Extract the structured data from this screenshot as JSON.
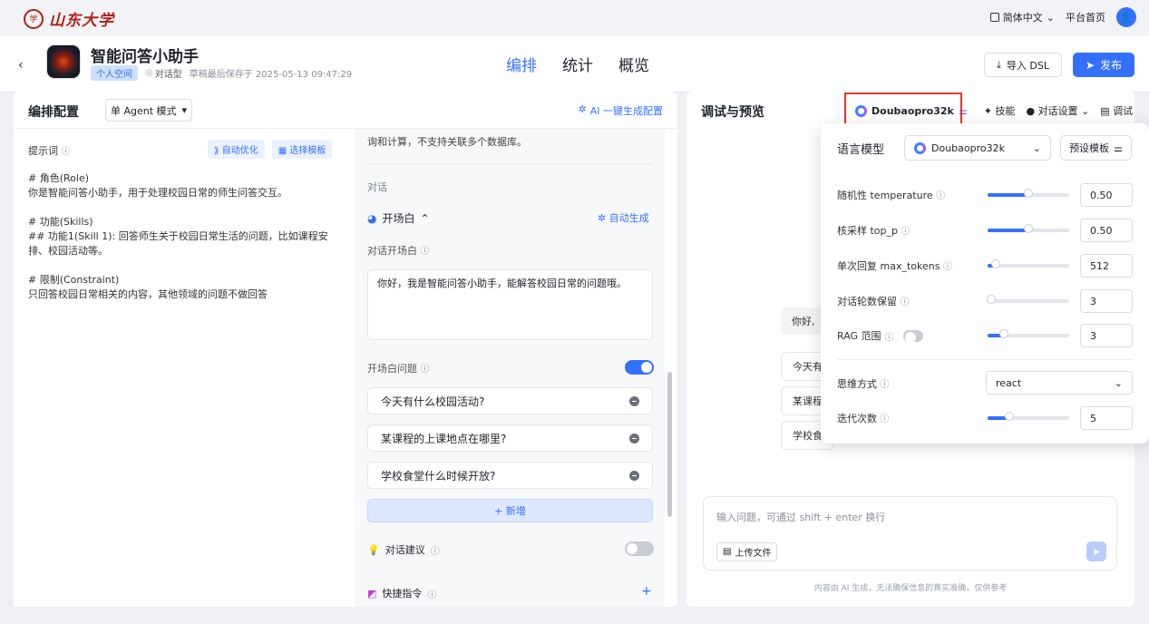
{
  "topbar": {
    "logo_text": "山东大学",
    "seal_text": "学",
    "language": "简体中文",
    "language_chevron": "⌄",
    "platform_home": "平台首页",
    "avatar_glyph": "👤"
  },
  "header": {
    "back_glyph": "‹",
    "app_title": "智能问答小助手",
    "space_tag": "个人空间",
    "type": "对话型",
    "saved_at": "草稿最后保存于 2025-05-13 09:47:29",
    "tabs": [
      {
        "label": "编排",
        "active": true
      },
      {
        "label": "统计",
        "active": false
      },
      {
        "label": "概览",
        "active": false
      }
    ],
    "import_dsl": "导入 DSL",
    "publish": "发布"
  },
  "left_panel": {
    "title": "编排配置",
    "mode": "单 Agent 模式",
    "ai_generate": "AI 一键生成配置",
    "prompt": {
      "label": "提示词",
      "auto_optimize": "自动优化",
      "choose_template": "选择模板",
      "lines": [
        "# 角色(Role)",
        "你是智能问答小助手，用于处理校园日常的师生问答交互。",
        "",
        "# 功能(Skills)",
        "## 功能1(Skill 1): 回答师生关于校园日常生活的问题，比如课程安排、校园活动等。",
        "",
        "# 限制(Constraint)",
        "只回答校园日常相关的内容，其他领域的问题不做回答"
      ]
    },
    "dialog": {
      "top_note": "询和计算，不支持关联多个数据库。",
      "section_title": "对话",
      "opening_title": "开场白",
      "auto_generate": "自动生成",
      "opening_label": "对话开场白",
      "opening_text": "你好，我是智能问答小助手，能解答校园日常的问题哦。",
      "opening_questions_label": "开场白问题",
      "opening_questions_enabled": true,
      "questions": [
        "今天有什么校园活动?",
        "某课程的上课地点在哪里?",
        "学校食堂什么时候开放?"
      ],
      "add_label": "+ 新增",
      "suggestions_label": "对话建议",
      "suggestions_enabled": false,
      "shortcuts_label": "快捷指令",
      "shortcuts_add": "+"
    }
  },
  "right_panel": {
    "title": "调试与预览",
    "model_name": "Doubaopro32k",
    "tools": [
      {
        "label": "技能",
        "chevron": ""
      },
      {
        "label": "对话设置",
        "chevron": "⌄"
      },
      {
        "label": "调试",
        "chevron": ""
      }
    ],
    "preview_bubbles": [
      "你好,",
      "今天有",
      "某课程",
      "学校食"
    ],
    "input_placeholder": "输入问题，可通过 shift + enter 换行",
    "upload_label": "上传文件",
    "disclaimer": "内容由 AI 生成，无法确保信息的真实准确，仅供参考"
  },
  "model_popover": {
    "model_label": "语言模型",
    "model_value": "Doubaopro32k",
    "preset_label": "预设模板",
    "params": [
      {
        "label": "随机性 temperature",
        "value": "0.50",
        "fraction": 0.5
      },
      {
        "label": "核采样 top_p",
        "value": "0.50",
        "fraction": 0.5
      },
      {
        "label": "单次回复 max_tokens",
        "value": "512",
        "fraction": 0.1
      },
      {
        "label": "对话轮数保留",
        "value": "3",
        "fraction": 0.04
      },
      {
        "label": "RAG 范围",
        "value": "3",
        "fraction": 0.2,
        "toggle": false
      },
      {
        "label": "迭代次数",
        "value": "5",
        "fraction": 0.27
      }
    ],
    "think_label": "思维方式",
    "think_value": "react"
  },
  "colors": {
    "accent": "#3370ff",
    "brand_red": "#b3201a",
    "highlight_box": "#e5322d"
  }
}
